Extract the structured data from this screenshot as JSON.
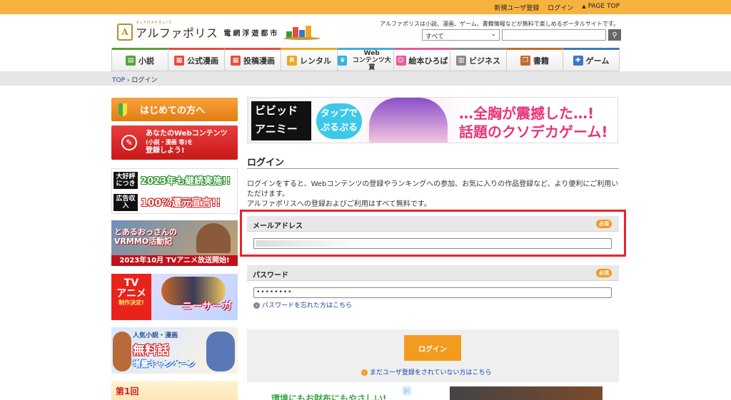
{
  "topbar": {
    "register": "新規ユーザ登録",
    "login": "ログイン",
    "pagetop": "PAGE TOP"
  },
  "header": {
    "logo_sub": "ALPHAPOLIS",
    "logo_text": "アルファポリス",
    "logo_city": "電網浮遊都市",
    "tagline": "アルファポリスは小説、漫画、ゲーム、書籍情報などが無料で楽しめるポータルサイトです。",
    "search_category": "すべて",
    "search_placeholder": ""
  },
  "nav": [
    {
      "label": "小説",
      "color": "#5aa03c"
    },
    {
      "label": "公式漫画",
      "color": "#e84c3d"
    },
    {
      "label": "投稿漫画",
      "color": "#e84c3d"
    },
    {
      "label": "レンタル",
      "color": "#f2a620"
    },
    {
      "label": "Web\nコンテンツ大賞",
      "color": "#3ab0d8"
    },
    {
      "label": "絵本ひろば",
      "color": "#e85a9a"
    },
    {
      "label": "ビジネス",
      "color": "#8a8a8a"
    },
    {
      "label": "書籍",
      "color": "#c86a2a"
    },
    {
      "label": "ゲーム",
      "color": "#3a78c8"
    }
  ],
  "breadcrumb": {
    "top": "TOP",
    "sep": " › ",
    "current": "ログイン"
  },
  "sidebar": {
    "first_time": "はじめての方へ",
    "register_lines": [
      "あなたのWebコンテンツ",
      "(小説・漫画 等)を",
      "登録しよう!"
    ],
    "promo1_tag_a": "大好評につき",
    "promo1_big_a": "2023年も継続実施!!",
    "promo1_tag_b": "広告収入",
    "promo1_big_b": "100%還元宣言!!",
    "banner_vrmmo_title": "とあるおっさんのVRMMO活動記",
    "banner_vrmmo_caption": "2023年10月 TVアニメ放送開始!",
    "banner_tv_a": "TV",
    "banner_tv_b": "アニメ",
    "banner_tv_c": "制作決定!",
    "banner_tv_title": "ニーサーガ",
    "banner_free_a": "人気小説・漫画",
    "banner_free_b": "無料話",
    "banner_free_c": "増量キャンペーン",
    "banner_bottom": "第1回"
  },
  "hero": {
    "logo_line1": "ビビッド",
    "logo_line2": "アニミー",
    "bubble": "タップで\nぷるぷる",
    "copy1": "…全胸が震撼した…!",
    "copy2": "話題のクソデカゲーム!"
  },
  "main": {
    "title": "ログイン",
    "intro_line1": "ログインをすると、Webコンテンツの登録やランキングへの参加、お気に入りの作品登録など、より便利にご利用いただけます。",
    "intro_line2": "アルファポリスへの登録およびご利用はすべて無料です。",
    "email_label": "メールアドレス",
    "required": "必須",
    "password_label": "パスワード",
    "password_value": "••••••••",
    "forgot": "パスワードを忘れた方はこちら",
    "submit": "ログイン",
    "register_link": "まだユーザ登録をされていない方はこちら"
  },
  "ads": {
    "ad1_text": "環境にもお財布にもやさしい!"
  }
}
